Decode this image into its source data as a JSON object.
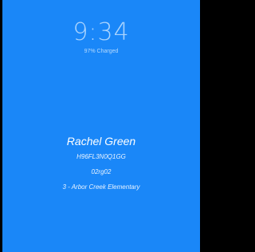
{
  "lock_screen": {
    "time": "9:34",
    "battery_status": "97% Charged",
    "background_color": "#1a87f8"
  },
  "user": {
    "name": "Rachel Green",
    "device_id": "H96FL3N0Q1GG",
    "group_code": "02rg02",
    "school": "3 - Arbor Creek Elementary"
  }
}
